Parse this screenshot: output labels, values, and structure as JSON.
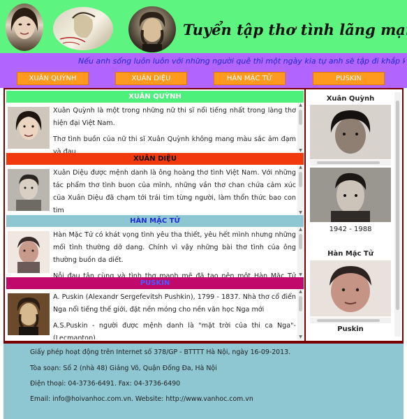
{
  "header": {
    "title": "Tuyển tập thơ tình lãng mạn"
  },
  "nav": {
    "marquee": "Nếu anh sống luôn luôn với những người quê thì một ngày kia tự anh sẽ tập đi khắp khênh...",
    "buttons": [
      "XUÂN QUỲNH",
      "XUÂN DIỆU",
      "HÀN MẶC TỬ",
      "PUSKIN"
    ]
  },
  "sections": [
    {
      "heading": "XUÂN QUỲNH",
      "heading_bg": "#4cf07a",
      "heading_color": "#ffffff",
      "paragraphs": [
        "Xuân Quỳnh là một trong những nữ thi sĩ nổi tiếng nhất trong làng thơ hiện đại Việt Nam.",
        "Thơ tình buồn của nữ thi sĩ Xuân Quỳnh không mang màu sắc ảm đạm và đau"
      ]
    },
    {
      "heading": "XUÂN DIỆU",
      "heading_bg": "#f2390e",
      "heading_color": "#111111",
      "paragraphs": [
        "Xuân Diệu được mệnh danh là ông hoàng thơ tình Việt Nam. Với những tác phẩm thơ tình buon của mình, những vần thơ chan chứa cảm xúc của Xuân Diệu đã chạm tới trái tim từng người, làm thổn thức bao con tim"
      ]
    },
    {
      "heading": "HÀN MẶC TỬ",
      "heading_bg": "#8ec7d1",
      "heading_color": "#1f2bd6",
      "paragraphs": [
        "Hàn Mặc Tử có khát vọng tình yêu tha thiết, yêu hết mình nhưng những mối tình thường dở dang. Chính vì vậy những bài thơ tình của ông thường buồn da diết.",
        "Nỗi đau tận cùng và tình thơ mạnh mẽ đã tạo nên một Hàn Mặc Tử trong lòng"
      ]
    },
    {
      "heading": "PUSKIN",
      "heading_bg": "#c1096b",
      "heading_color": "#4a5cff",
      "paragraphs": [
        "A. Puskin (Alexandr Sergefevitsh Pushkin), 1799 - 1837. Nhà thơ cổ điển Nga nổi tiếng thế giới, đặt nền móng cho nền văn học Nga mới",
        "A.S.Puskin - người được mệnh danh là \"mặt trời của thi ca Nga\"- (Lecmantop)."
      ]
    }
  ],
  "sidebar": {
    "name_1": "Xuân Quỳnh",
    "years_2": "1942 - 1988",
    "name_3": "Hàn Mặc Tử",
    "name_4": "Puskin"
  },
  "footer": {
    "lines": [
      "Giấy phép hoạt động trên Internet số 378/GP - BTTTT Hà Nội, ngày 16-09-2013.",
      "Tòa soạn: Số 2 (nhà 48) Giảng Võ, Quận Đống Đa, Hà Nội",
      "Điện thoại: 04-3736-6491. Fax: 04-3736-6490",
      "Email: info@hoivanhoc.com.vn. Website: http://www.vanhoc.com.vn"
    ]
  },
  "colors": {
    "header_bg": "#5df57f",
    "nav_bg": "#b264ff",
    "nav_button": "#ff9a1e",
    "border": "#7a0000",
    "footer_bg": "#8ec7d1"
  },
  "icons": {
    "scroll_up": "triangle-up-icon",
    "scroll_down": "triangle-down-icon"
  }
}
